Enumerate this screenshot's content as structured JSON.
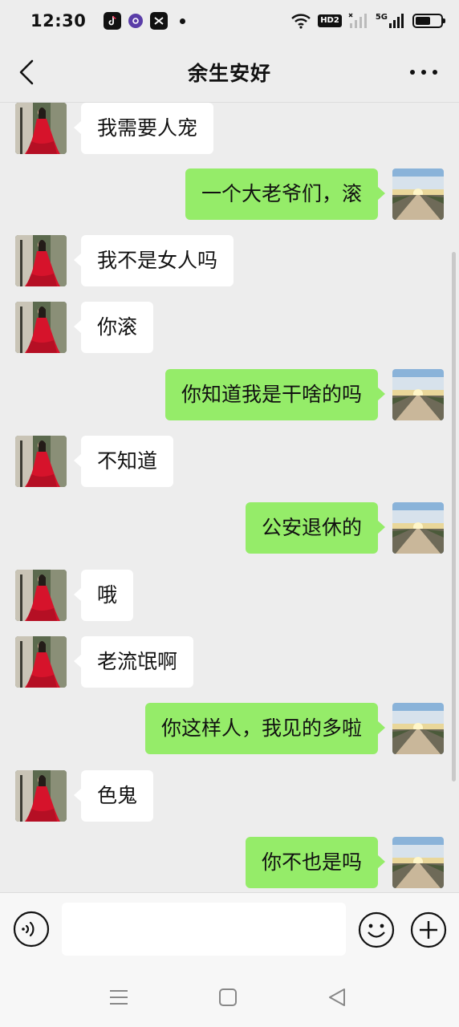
{
  "status_bar": {
    "time": "12:30",
    "hd_label": "HD2",
    "network_label": "5G",
    "battery_level": 0.6,
    "app_icons": [
      "tiktok-icon",
      "circle-app-icon",
      "capcut-icon"
    ]
  },
  "header": {
    "title": "余生安好"
  },
  "messages": [
    {
      "side": "in",
      "text": "我需要人宠"
    },
    {
      "side": "out",
      "text": "一个大老爷们，滚"
    },
    {
      "side": "in",
      "text": "我不是女人吗"
    },
    {
      "side": "in",
      "text": "你滚"
    },
    {
      "side": "out",
      "text": "你知道我是干啥的吗"
    },
    {
      "side": "in",
      "text": "不知道"
    },
    {
      "side": "out",
      "text": "公安退休的"
    },
    {
      "side": "in",
      "text": "哦"
    },
    {
      "side": "in",
      "text": "老流氓啊"
    },
    {
      "side": "out",
      "text": "你这样人，我见的多啦"
    },
    {
      "side": "in",
      "text": "色鬼"
    },
    {
      "side": "out",
      "text": "你不也是吗"
    }
  ],
  "input_bar": {
    "text_value": "",
    "placeholder": ""
  },
  "colors": {
    "background": "#ededed",
    "incoming_bubble": "#ffffff",
    "outgoing_bubble": "#95ec69",
    "contact_avatar_dress": "#d6132b"
  }
}
